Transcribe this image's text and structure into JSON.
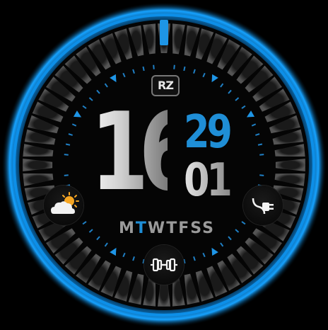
{
  "watchface": {
    "brand_logo": "RZ",
    "time": {
      "hour": "16",
      "minute": "29",
      "second": "01"
    },
    "weekdays": [
      "M",
      "T",
      "W",
      "T",
      "F",
      "S",
      "S"
    ],
    "active_weekday_index": 1,
    "complications": {
      "weather": {
        "icon": "partly-cloudy-icon"
      },
      "charging": {
        "icon": "plug-icon"
      },
      "workout": {
        "icon": "dumbbell-icon"
      }
    },
    "seconds_progress": 0.0,
    "colors": {
      "accent": "#1f8ed6",
      "ring": "#0a7fd0",
      "background": "#000000"
    }
  }
}
